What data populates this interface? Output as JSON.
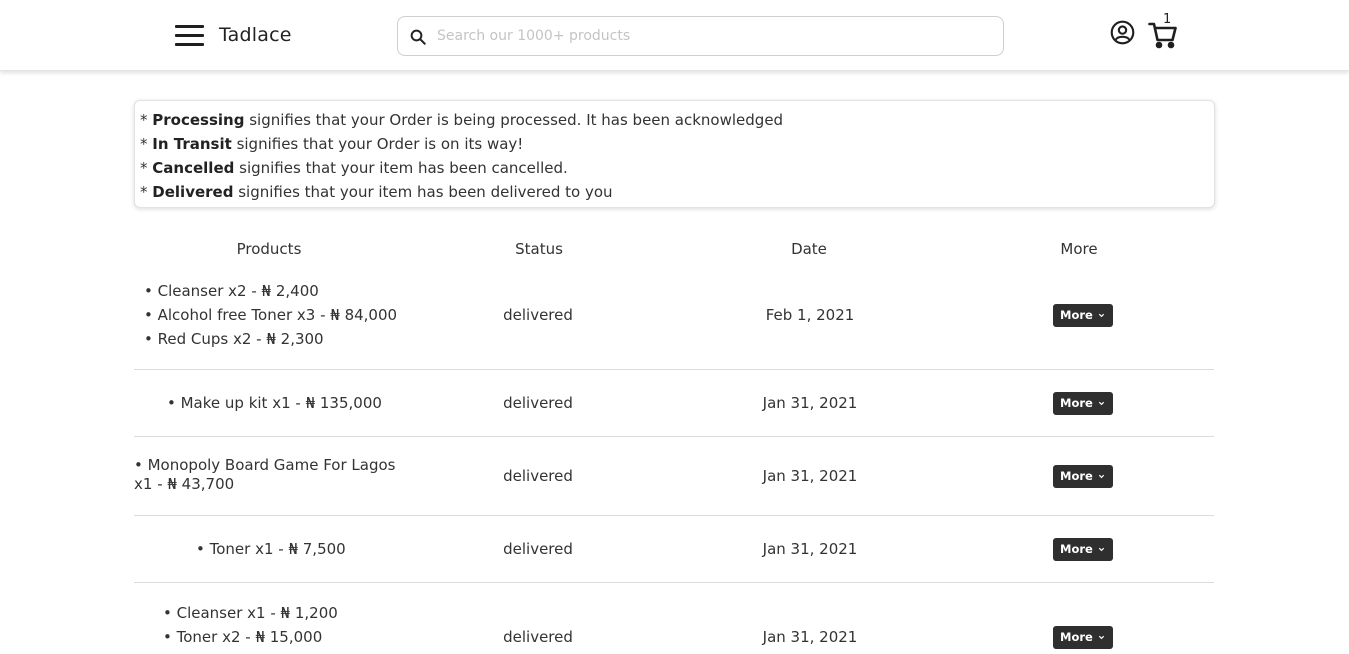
{
  "header": {
    "brand": "Tadlace",
    "search_placeholder": "Search our 1000+ products",
    "cart_count": "1"
  },
  "legend": [
    {
      "term": "Processing",
      "text": " signifies that your Order is being processed. It has been acknowledged"
    },
    {
      "term": "In Transit",
      "text": " signifies that your Order is on its way!"
    },
    {
      "term": "Cancelled",
      "text": " signifies that your item has been cancelled."
    },
    {
      "term": "Delivered",
      "text": " signifies that your item has been delivered to you"
    }
  ],
  "legend_prefix": "* ",
  "table": {
    "headers": [
      "Products",
      "Status",
      "Date",
      "More"
    ],
    "more_label": "More",
    "rows": [
      {
        "products": [
          "• Cleanser x2 - ₦ 2,400",
          "• Alcohol free Toner x3 - ₦ 84,000",
          "• Red Cups x2 - ₦ 2,300"
        ],
        "status": "delivered",
        "date": "Feb 1, 2021"
      },
      {
        "products": [
          "• Make up kit x1 - ₦ 135,000"
        ],
        "status": "delivered",
        "date": "Jan 31, 2021"
      },
      {
        "products": [
          "• Monopoly Board Game For Lagos x1 - ₦ 43,700"
        ],
        "status": "delivered",
        "date": "Jan 31, 2021"
      },
      {
        "products": [
          "• Toner x1 - ₦ 7,500"
        ],
        "status": "delivered",
        "date": "Jan 31, 2021"
      },
      {
        "products": [
          "• Cleanser x1 - ₦ 1,200",
          "• Toner x2 - ₦ 15,000"
        ],
        "status": "delivered",
        "date": "Jan 31, 2021"
      }
    ]
  }
}
